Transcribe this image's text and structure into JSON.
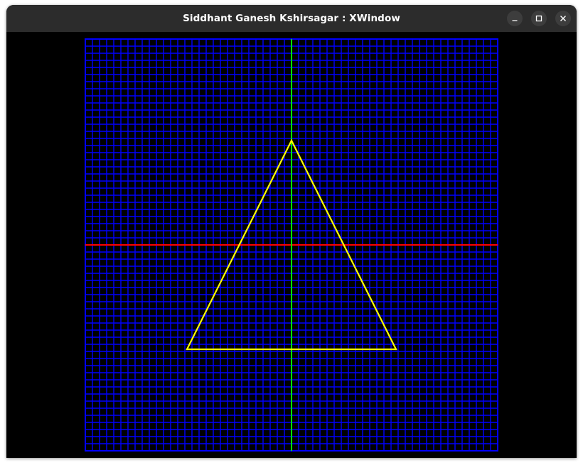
{
  "window": {
    "title": "Siddhant Ganesh Kshirsagar : XWindow",
    "buttons": {
      "minimize_icon": "minimize-icon",
      "maximize_icon": "maximize-icon",
      "close_icon": "close-icon"
    }
  },
  "colors": {
    "titlebar": "#2c2c2c",
    "canvas_background": "#000000",
    "grid": "#0000ff",
    "x_axis": "#ff0000",
    "y_axis": "#00ff00",
    "triangle": "#ffff00"
  },
  "chart_data": {
    "type": "line",
    "grid": true,
    "xlim": [
      -290,
      290
    ],
    "ylim": [
      -290,
      290
    ],
    "grid_step": 10,
    "axes": [
      {
        "name": "x-axis",
        "color": "#ff0000"
      },
      {
        "name": "y-axis",
        "color": "#00ff00"
      }
    ],
    "series": [
      {
        "color": "#ffff00",
        "closed": true,
        "x": [
          0,
          -147,
          147
        ],
        "y": [
          147,
          -147,
          -147
        ]
      }
    ]
  }
}
